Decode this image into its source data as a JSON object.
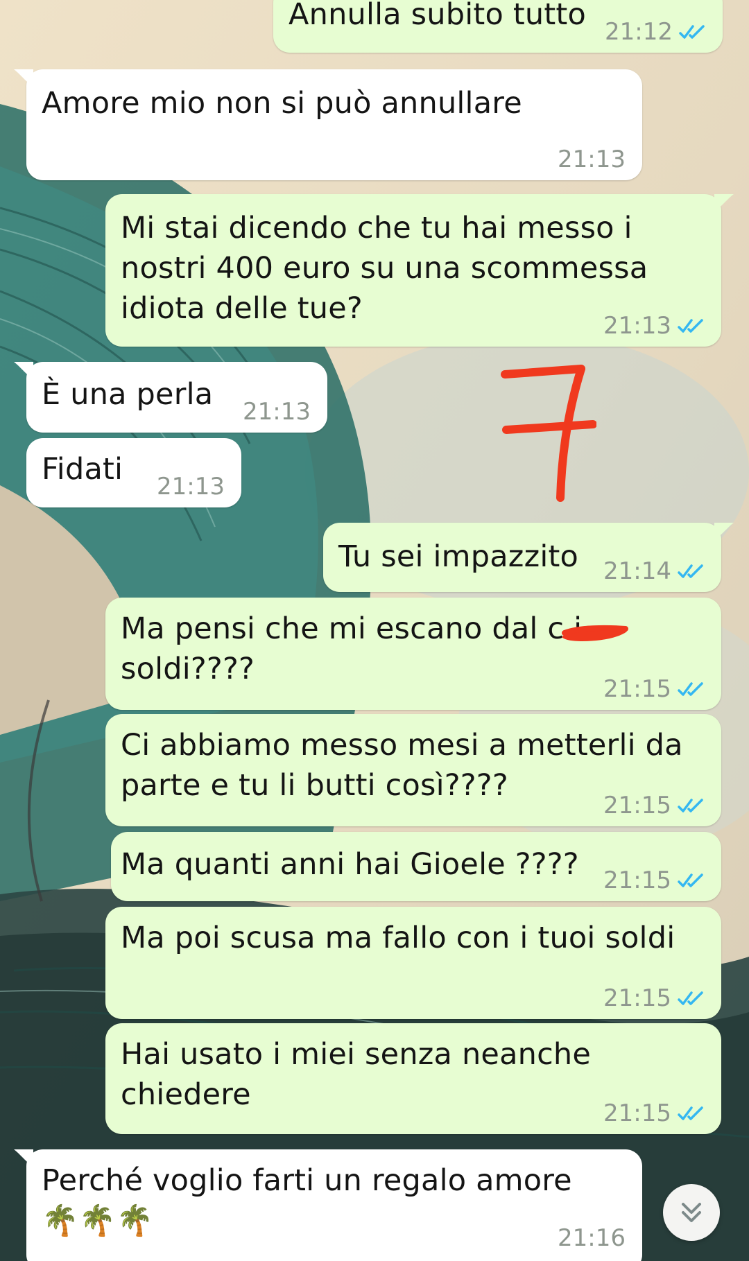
{
  "chat": {
    "messages": [
      {
        "dir": "out",
        "text": "Annulla subito tutto",
        "time": "21:12",
        "read": true
      },
      {
        "dir": "in",
        "text": "Amore mio non si può annullare",
        "time": "21:13"
      },
      {
        "dir": "out",
        "text": "Mi stai dicendo che tu hai messo i\nnostri 400 euro su una scommessa\nidiota delle tue?",
        "time": "21:13",
        "read": true
      },
      {
        "dir": "in",
        "text": "È una perla",
        "time": "21:13"
      },
      {
        "dir": "in",
        "text": "Fidati",
        "time": "21:13"
      },
      {
        "dir": "out",
        "text": "Tu sei impazzito",
        "time": "21:14",
        "read": true
      },
      {
        "dir": "out",
        "text": "Ma pensi che mi escano dal c      i\nsoldi????",
        "time": "21:15",
        "read": true
      },
      {
        "dir": "out",
        "text": "Ci abbiamo messo mesi a metterli da\nparte e tu li butti così????",
        "time": "21:15",
        "read": true
      },
      {
        "dir": "out",
        "text": " Ma quanti anni hai Gioele ????",
        "time": "21:15",
        "read": true
      },
      {
        "dir": "out",
        "text": "Ma poi scusa ma fallo con i tuoi soldi",
        "time": "21:15",
        "read": true
      },
      {
        "dir": "out",
        "text": "Hai usato i miei senza neanche\nchiedere",
        "time": "21:15",
        "read": true
      },
      {
        "dir": "in",
        "text": "Perché voglio farti un regalo amore\n🌴🌴🌴",
        "time": "21:16"
      }
    ]
  },
  "annotation": {
    "text": "7",
    "color": "#f0391e"
  },
  "colors": {
    "incoming": "#ffffff",
    "outgoing": "#e7fdd2",
    "read_ticks": "#34b7f1",
    "time": "#8e968e"
  },
  "icons": {
    "read_receipt": "double-check-icon",
    "scroll_down": "chevron-double-down-icon"
  }
}
